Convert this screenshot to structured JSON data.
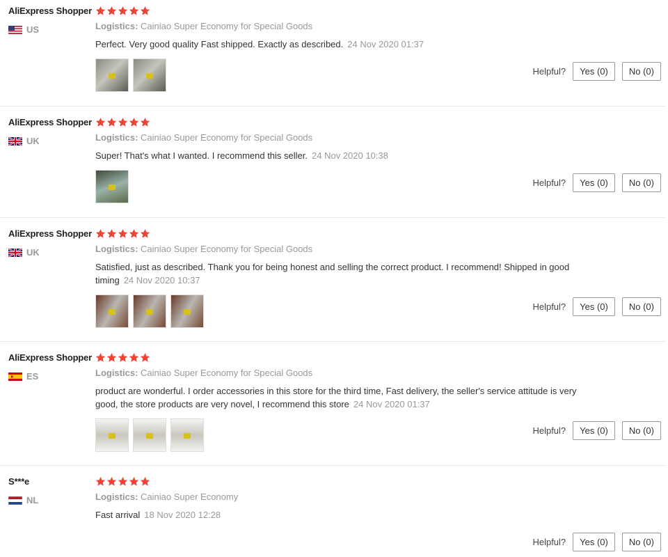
{
  "reviews": [
    {
      "user": "AliExpress Shopper",
      "country": "US",
      "flag": "us-flag-icon",
      "rating": 5,
      "logistics_label": "Logistics:",
      "logistics": "Cainiao Super Economy for Special Goods",
      "text": "Perfect. Very good quality Fast shipped. Exactly as described.",
      "date": "24 Nov 2020 01:37",
      "photos": 2,
      "helpful_label": "Helpful?",
      "yes_label": "Yes (0)",
      "no_label": "No (0)"
    },
    {
      "user": "AliExpress Shopper",
      "country": "UK",
      "flag": "uk-flag-icon",
      "rating": 5,
      "logistics_label": "Logistics:",
      "logistics": "Cainiao Super Economy for Special Goods",
      "text": "Super! That's what I wanted. I recommend this seller.",
      "date": "24 Nov 2020 10:38",
      "photos": 1,
      "helpful_label": "Helpful?",
      "yes_label": "Yes (0)",
      "no_label": "No (0)"
    },
    {
      "user": "AliExpress Shopper",
      "country": "UK",
      "flag": "uk-flag-icon",
      "rating": 5,
      "logistics_label": "Logistics:",
      "logistics": "Cainiao Super Economy for Special Goods",
      "text": "Satisfied, just as described. Thank you for being honest and selling the correct product. I recommend! Shipped in good timing",
      "date": "24 Nov 2020 10:37",
      "photos": 3,
      "helpful_label": "Helpful?",
      "yes_label": "Yes (0)",
      "no_label": "No (0)"
    },
    {
      "user": "AliExpress Shopper",
      "country": "ES",
      "flag": "es-flag-icon",
      "rating": 5,
      "logistics_label": "Logistics:",
      "logistics": "Cainiao Super Economy for Special Goods",
      "text": "product are wonderful. I order accessories in this store for the third time, Fast delivery, the seller's service attitude is very good, the store products are very novel, I recommend this store",
      "date": "24 Nov 2020 01:37",
      "photos": 3,
      "helpful_label": "Helpful?",
      "yes_label": "Yes (0)",
      "no_label": "No (0)"
    },
    {
      "user": "S***e",
      "country": "NL",
      "flag": "nl-flag-icon",
      "rating": 5,
      "logistics_label": "Logistics:",
      "logistics": "Cainiao Super Economy",
      "text": "Fast arrival",
      "date": "18 Nov 2020 12:28",
      "photos": 0,
      "helpful_label": "Helpful?",
      "yes_label": "Yes (0)",
      "no_label": "No (0)"
    }
  ],
  "colors": {
    "star": "#f44336",
    "muted": "#999999",
    "text": "#333333",
    "divider": "#e8e8e8"
  }
}
